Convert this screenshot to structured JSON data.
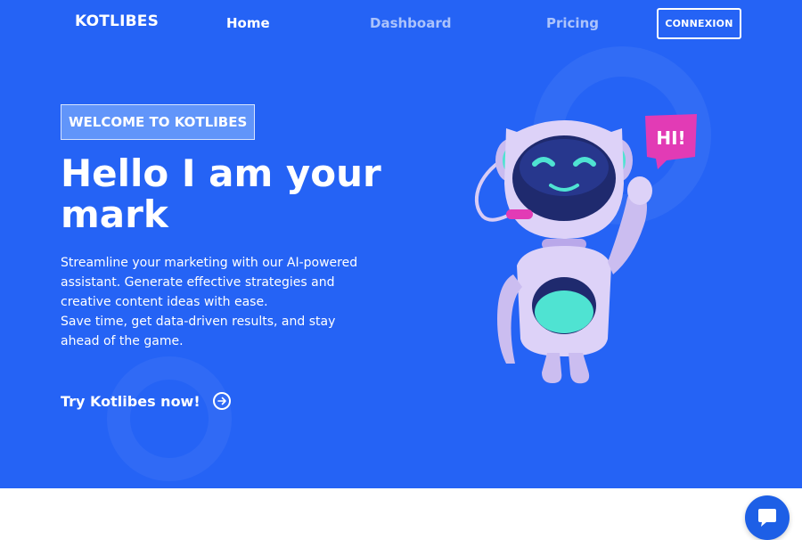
{
  "nav": {
    "logo": "KOTLIBES",
    "links": [
      {
        "label": "Home"
      },
      {
        "label": "Dashboard"
      },
      {
        "label": "Pricing"
      }
    ],
    "login_label": "CONNEXION"
  },
  "hero": {
    "badge": "WELCOME TO KOTLIBES",
    "headline": "Hello I am your mark",
    "description_lines": [
      "Streamline your marketing with our AI-powered",
      "assistant. Generate effective strategies and",
      "creative content ideas with ease.",
      "Save time, get data-driven results, and stay",
      "ahead of the game."
    ],
    "cta_label": "Try Kotlibes now!",
    "speech_bubble": "HI!"
  },
  "colors": {
    "hero_bg": "#2563f5",
    "accent_pink": "#e23bb5",
    "robot_body": "#d8ccf5",
    "visor": "#1f2a6e",
    "teal": "#4fe3d2"
  },
  "icons": {
    "cta": "arrow-right-circle-icon",
    "chat": "chat-bubble-icon"
  }
}
